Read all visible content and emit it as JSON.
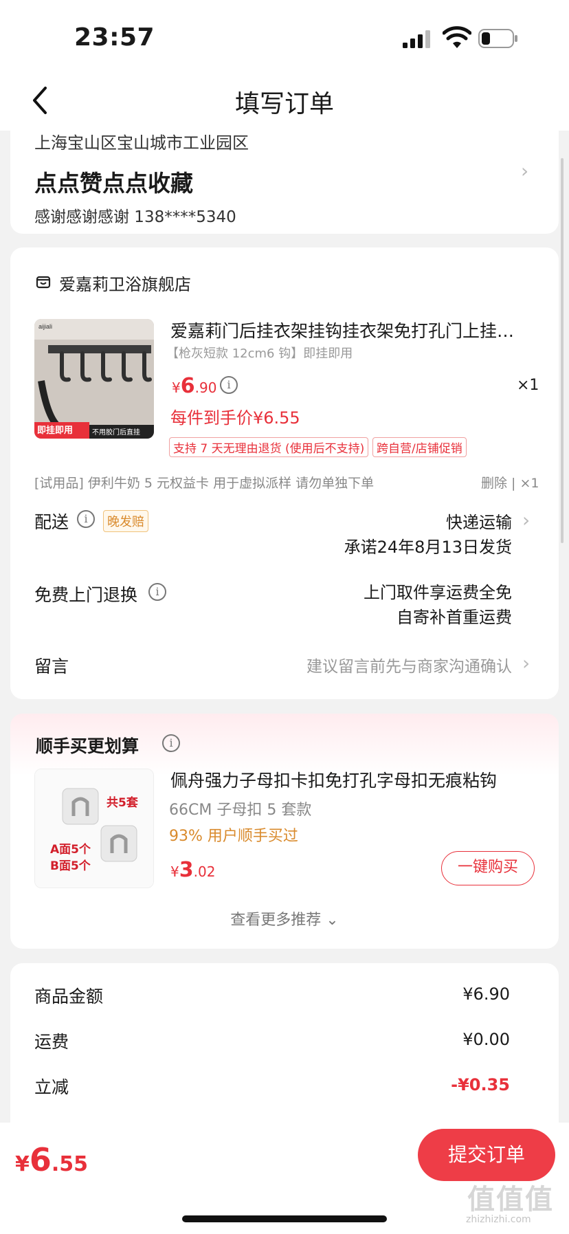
{
  "status_bar": {
    "time": "23:57"
  },
  "nav": {
    "title": "填写订单"
  },
  "address": {
    "region": "上海宝山区宝山城市工业园区",
    "detail": "点点赞点点收藏",
    "contact": "感谢感谢感谢  138****5340"
  },
  "store": {
    "name": "爱嘉莉卫浴旗舰店"
  },
  "product": {
    "title": "爱嘉莉门后挂衣架挂钩挂衣架免打孔门上挂衣钩",
    "spec": "【枪灰短款 12cm6 钩】即挂即用",
    "price_symbol": "¥",
    "price_int": "6",
    "price_dec": ".90",
    "quantity": "×1",
    "final_price": "每件到手价¥6.55",
    "tags": [
      "支持 7 天无理由退货 (使用后不支持)",
      "跨自营/店铺促销"
    ],
    "image_brand": "aijiali",
    "image_banner_left": "即挂即用",
    "image_banner_right": "不用胶门后直挂"
  },
  "trial": {
    "text": "[试用品] 伊利牛奶 5 元权益卡 用于虚拟派样 请勿单独下单",
    "actions": "删除 | ×1"
  },
  "delivery": {
    "label": "配送",
    "badge": "晚发赔",
    "method": "快递运输",
    "promise": "承诺24年8月13日发货"
  },
  "returns": {
    "label": "免费上门退换",
    "line1": "上门取件享运费全免",
    "line2": "自寄补首重运费"
  },
  "memo": {
    "label": "留言",
    "placeholder": "建议留言前先与商家沟通确认"
  },
  "recommend": {
    "title": "顺手买更划算",
    "name": "佩舟强力子母扣卡扣免打孔字母扣无痕粘钩",
    "spec": "66CM 子母扣 5 套款",
    "stat": "93% 用户顺手买过",
    "price_symbol": "¥",
    "price_int": "3",
    "price_dec": ".02",
    "buy_label": "一键购买",
    "more_label": "查看更多推荐 ⌄",
    "image_tag": "共5套",
    "image_line1": "A面5个",
    "image_line2": "B面5个"
  },
  "summary": {
    "rows": [
      {
        "label": "商品金额",
        "value": "¥6.90"
      },
      {
        "label": "运费",
        "value": "¥0.00"
      },
      {
        "label": "立减",
        "value": "-¥0.35"
      }
    ]
  },
  "bottom": {
    "currency": "¥",
    "total_int": "6",
    "total_dec": ".55",
    "submit_label": "提交订单"
  },
  "watermark": {
    "main": "值值值",
    "sub": "zhizhizhi.com"
  },
  "colors": {
    "accent": "#e8303a",
    "button": "#ee3d47",
    "warning": "#d98a2c",
    "background": "#f2f2f2"
  }
}
